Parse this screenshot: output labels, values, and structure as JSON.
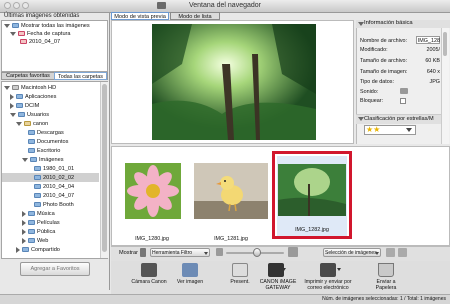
{
  "window": {
    "title": "Ventana del navegador"
  },
  "recent_panel": {
    "header": "Últimas imágenes obtenidas",
    "items": [
      {
        "label": "Mostrar todas las imágenes"
      },
      {
        "label": "Fecha de captura"
      },
      {
        "label": "2010_04_07"
      }
    ]
  },
  "folder_tabs": {
    "favorites": "Carpetas favoritas",
    "all": "Todas las carpetas"
  },
  "tree": [
    "Macintosh HD",
    "Aplicaciones",
    "DCIM",
    "Usuarios",
    "canon",
    "Descargas",
    "Documentos",
    "Escritorio",
    "Imágenes",
    "1980_01_01",
    "2010_02_02",
    "2010_04_04",
    "2010_04_07",
    "Photo Booth",
    "Música",
    "Películas",
    "Pública",
    "Web",
    "Compartido"
  ],
  "add_favorites": "Agregar a Favoritos",
  "view_tabs": {
    "preview": "Modo de vista previa",
    "list": "Modo de lista"
  },
  "info": {
    "header": "Información básica",
    "rows": [
      {
        "label": "Nombre de archivo:",
        "value": "IMG_128"
      },
      {
        "label": "Modificado:",
        "value": "2005/"
      },
      {
        "label": "Tamaño de archivo:",
        "value": "60 KB"
      },
      {
        "label": "Tamaño de imagen:",
        "value": "640 x"
      },
      {
        "label": "Tipo de datos:",
        "value": "JPG"
      },
      {
        "label": "Sonido:",
        "value": ""
      },
      {
        "label": "Bloquear:",
        "value": ""
      }
    ],
    "rating_header": "Clasificación por estrellas/M",
    "stars": "★★"
  },
  "thumbnails": [
    {
      "caption": "IMG_1280.jpg"
    },
    {
      "caption": "IMG_1281.jpg"
    },
    {
      "caption": "IMG_1282.jpg"
    }
  ],
  "toolbar": {
    "show_label": "Mostrar",
    "filter_label": "Herramienta Filtro",
    "selection_label": "Selección de imágenes"
  },
  "tools": [
    {
      "label": "Cámara Canon"
    },
    {
      "label": "Ver imagen"
    },
    {
      "label": "Present."
    },
    {
      "label": "CANON iMAGE GATEWAY"
    },
    {
      "label": "Imprimir y enviar por correo electrónico"
    },
    {
      "label": "Enviar a Papelera"
    }
  ],
  "status": "Núm. de imágenes seleccionadas: 1 / Total: 1 imágenes"
}
